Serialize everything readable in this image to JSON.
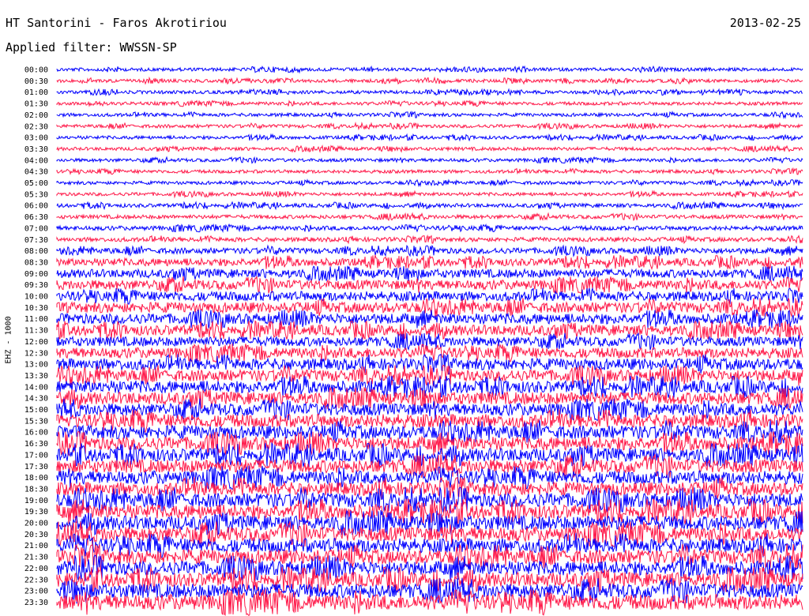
{
  "header": {
    "station": "HT Santorini - Faros Akrotiriou",
    "date": "2013-02-25",
    "filter": "Applied filter: WWSSN-SP"
  },
  "chart_data": {
    "type": "line",
    "title": "HT Santorini - Faros Akrotiriou",
    "ylabel": "EHZ - 1000",
    "y_tick_labels": [
      "00:00",
      "00:30",
      "01:00",
      "01:30",
      "02:00",
      "02:30",
      "03:00",
      "03:30",
      "04:00",
      "04:30",
      "05:00",
      "05:30",
      "06:00",
      "06:30",
      "07:00",
      "07:30",
      "08:00",
      "08:30",
      "09:00",
      "09:30",
      "10:00",
      "10:30",
      "11:00",
      "11:30",
      "12:00",
      "12:30",
      "13:00",
      "13:30",
      "14:00",
      "14:30",
      "15:00",
      "15:30",
      "16:00",
      "16:30",
      "17:00",
      "17:30",
      "18:00",
      "18:30",
      "19:00",
      "19:30",
      "20:00",
      "20:30",
      "21:00",
      "21:30",
      "22:00",
      "22:30",
      "23:00",
      "23:30"
    ],
    "trace_colors": [
      "#0000ff",
      "#ff1a4a"
    ],
    "amplitude_levels": [
      0.35,
      0.35,
      0.35,
      0.35,
      0.35,
      0.35,
      0.35,
      0.35,
      0.35,
      0.35,
      0.35,
      0.35,
      0.4,
      0.4,
      0.45,
      0.45,
      0.6,
      0.8,
      0.9,
      1.0,
      1.0,
      1.1,
      1.1,
      1.1,
      1.0,
      1.1,
      1.2,
      1.2,
      1.3,
      1.3,
      1.3,
      1.4,
      1.4,
      1.4,
      1.4,
      1.4,
      1.4,
      1.4,
      1.5,
      1.5,
      1.5,
      1.5,
      1.5,
      1.5,
      1.5,
      1.5,
      1.5,
      1.6
    ],
    "grid": false
  }
}
